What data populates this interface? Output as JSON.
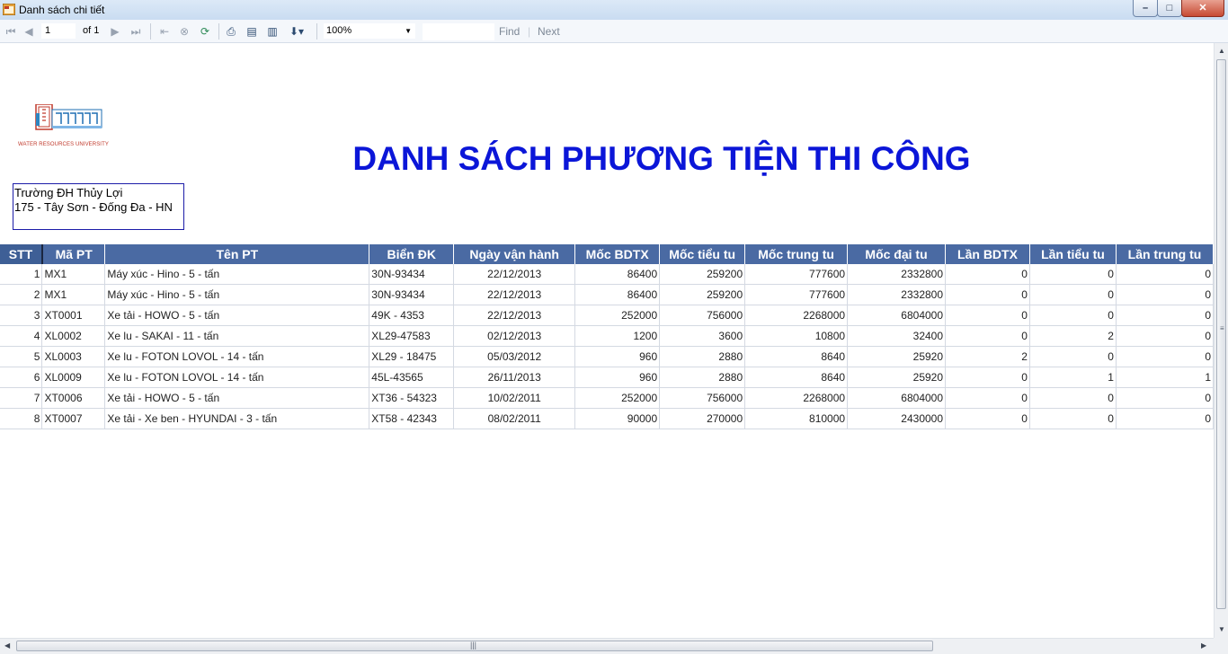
{
  "window": {
    "title": "Danh sách chi tiết",
    "minimize_glyph": "–",
    "maximize_glyph": "□",
    "close_glyph": "✕"
  },
  "toolbar": {
    "page_value": "1",
    "page_of": "of 1",
    "zoom_value": "100%",
    "find_label": "Find",
    "next_label": "Next",
    "icons": [
      "first-page-icon",
      "prev-page-icon",
      "next-page-icon",
      "last-page-icon",
      "back-icon",
      "stop-icon",
      "refresh-icon",
      "print-icon",
      "print-layout-icon",
      "page-setup-icon",
      "export-icon"
    ]
  },
  "report": {
    "logo_caption": "WATER RESOURCES UNIVERSITY",
    "title": "DANH SÁCH PHƯƠNG TIỆN THI CÔNG",
    "address_line1": "Trường ĐH Thủy Lợi",
    "address_line2": "175 - Tây Sơn - Đống Đa - HN"
  },
  "table": {
    "headers": [
      "STT",
      "Mã PT",
      "Tên PT",
      "Biển ĐK",
      "Ngày vận hành",
      "Mốc BDTX",
      "Mốc tiểu tu",
      "Mốc trung tu",
      "Mốc đại tu",
      "Lần BDTX",
      "Lần tiểu tu",
      "Lần trung tu"
    ],
    "rows": [
      [
        "1",
        "MX1",
        "Máy xúc  - Hino - 5  -  tấn",
        "30N-93434",
        "22/12/2013",
        "86400",
        "259200",
        "777600",
        "2332800",
        "0",
        "0",
        "0"
      ],
      [
        "2",
        "MX1",
        "Máy xúc  - Hino - 5  -  tấn",
        "30N-93434",
        "22/12/2013",
        "86400",
        "259200",
        "777600",
        "2332800",
        "0",
        "0",
        "0"
      ],
      [
        "3",
        "XT0001",
        "Xe tải  - HOWO - 5  -  tấn",
        "49K - 4353",
        "22/12/2013",
        "252000",
        "756000",
        "2268000",
        "6804000",
        "0",
        "0",
        "0"
      ],
      [
        "4",
        "XL0002",
        "Xe lu  - SAKAI - 11  -  tấn",
        "XL29-47583",
        "02/12/2013",
        "1200",
        "3600",
        "10800",
        "32400",
        "0",
        "2",
        "0"
      ],
      [
        "5",
        "XL0003",
        "Xe lu  - FOTON LOVOL - 14  -  tấn",
        "XL29 - 18475",
        "05/03/2012",
        "960",
        "2880",
        "8640",
        "25920",
        "2",
        "0",
        "0"
      ],
      [
        "6",
        "XL0009",
        "Xe lu  - FOTON LOVOL - 14  -  tấn",
        "45L-43565",
        "26/11/2013",
        "960",
        "2880",
        "8640",
        "25920",
        "0",
        "1",
        "1"
      ],
      [
        "7",
        "XT0006",
        "Xe tải  - HOWO - 5  -  tấn",
        "XT36 - 54323",
        "10/02/2011",
        "252000",
        "756000",
        "2268000",
        "6804000",
        "0",
        "0",
        "0"
      ],
      [
        "8",
        "XT0007",
        "Xe tải  - Xe ben - HYUNDAI - 3  -  tấn",
        "XT58 - 42343",
        "08/02/2011",
        "90000",
        "270000",
        "810000",
        "2430000",
        "0",
        "0",
        "0"
      ]
    ]
  },
  "colors": {
    "title_blue": "#0b16d8",
    "header_bg": "#4a6aa3",
    "address_border": "#1c1ca8"
  }
}
